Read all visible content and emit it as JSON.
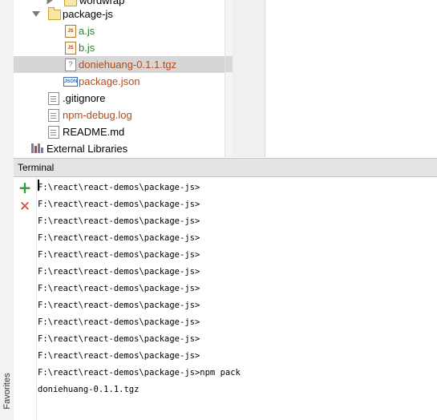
{
  "project_tree": {
    "items": [
      {
        "label": "wordwrap",
        "type": "folder",
        "color": "#000000"
      },
      {
        "label": "package-js",
        "type": "folder-open",
        "color": "#000000"
      },
      {
        "label": "a.js",
        "type": "js",
        "color": "#2e7d32"
      },
      {
        "label": "b.js",
        "type": "js",
        "color": "#2e7d32"
      },
      {
        "label": "doniehuang-0.1.1.tgz",
        "type": "archive",
        "color": "#b24a1b"
      },
      {
        "label": "package.json",
        "type": "json",
        "color": "#b24a1b"
      },
      {
        "label": ".gitignore",
        "type": "file",
        "color": "#000000"
      },
      {
        "label": "npm-debug.log",
        "type": "file",
        "color": "#b24a1b"
      },
      {
        "label": "README.md",
        "type": "file",
        "color": "#000000"
      },
      {
        "label": "External Libraries",
        "type": "library",
        "color": "#000000"
      }
    ],
    "selected_index": 4
  },
  "terminal": {
    "title": "Terminal",
    "lines": [
      "F:\\react\\react-demos\\package-js>",
      "F:\\react\\react-demos\\package-js>",
      "F:\\react\\react-demos\\package-js>",
      "F:\\react\\react-demos\\package-js>",
      "F:\\react\\react-demos\\package-js>",
      "F:\\react\\react-demos\\package-js>",
      "F:\\react\\react-demos\\package-js>",
      "F:\\react\\react-demos\\package-js>",
      "F:\\react\\react-demos\\package-js>",
      "F:\\react\\react-demos\\package-js>",
      "F:\\react\\react-demos\\package-js>",
      "F:\\react\\react-demos\\package-js>npm pack",
      "doniehuang-0.1.1.tgz"
    ],
    "add_icon": "plus-icon",
    "close_icon": "close-icon"
  },
  "sidebar": {
    "favorites_label": "Favorites"
  }
}
